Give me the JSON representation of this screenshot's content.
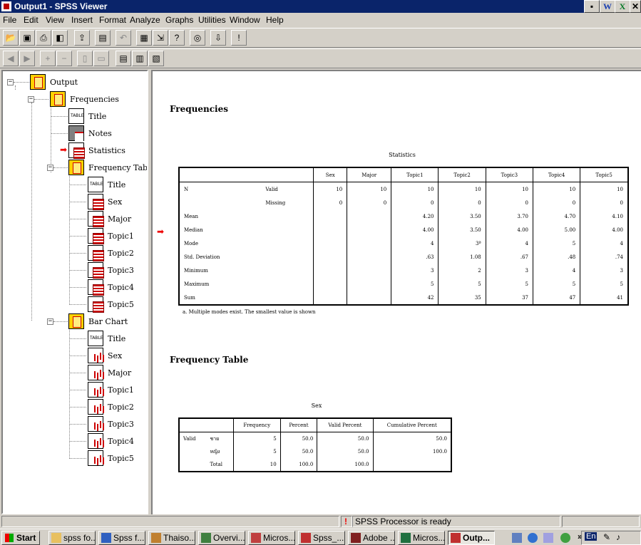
{
  "window": {
    "title": "Output1 - SPSS Viewer"
  },
  "office_icons": [
    "W",
    "X",
    "✕"
  ],
  "menu": [
    "File",
    "Edit",
    "View",
    "Insert",
    "Format",
    "Analyze",
    "Graphs",
    "Utilities",
    "Window",
    "Help"
  ],
  "toolbar1": [
    "open-icon",
    "save-icon",
    "print-icon",
    "print-preview-icon",
    "export-icon",
    "dialog-recall-icon",
    "undo-icon",
    "goto-data-icon",
    "goto-case-icon",
    "variables-icon",
    "use-sets-icon",
    "designate-window-icon",
    "info-icon"
  ],
  "toolbar2": [
    "promote-icon",
    "demote-icon",
    "expand-icon",
    "collapse-icon",
    "show-icon",
    "hide-icon",
    "insert-heading-icon",
    "insert-title-icon",
    "insert-text-icon"
  ],
  "tree": {
    "root": "Output",
    "frequencies": "Frequencies",
    "freq_children": [
      "Title",
      "Notes",
      "Statistics"
    ],
    "freq_table": "Frequency Table",
    "table_children": [
      "Title",
      "Sex",
      "Major",
      "Topic1",
      "Topic2",
      "Topic3",
      "Topic4",
      "Topic5"
    ],
    "bar_chart": "Bar Chart",
    "chart_children": [
      "Title",
      "Sex",
      "Major",
      "Topic1",
      "Topic2",
      "Topic3",
      "Topic4",
      "Topic5"
    ]
  },
  "content": {
    "heading1": "Frequencies",
    "stats_caption": "Statistics",
    "stats_columns": [
      "",
      "",
      "Sex",
      "Major",
      "Topic1",
      "Topic2",
      "Topic3",
      "Topic4",
      "Topic5"
    ],
    "stats_rows": [
      [
        "N",
        "Valid",
        "10",
        "10",
        "10",
        "10",
        "10",
        "10",
        "10"
      ],
      [
        "",
        "Missing",
        "0",
        "0",
        "0",
        "0",
        "0",
        "0",
        "0"
      ],
      [
        "Mean",
        "",
        "",
        "",
        "4.20",
        "3.50",
        "3.70",
        "4.70",
        "4.10"
      ],
      [
        "Median",
        "",
        "",
        "",
        "4.00",
        "3.50",
        "4.00",
        "5.00",
        "4.00"
      ],
      [
        "Mode",
        "",
        "",
        "",
        "4",
        "3ª",
        "4",
        "5",
        "4"
      ],
      [
        "Std. Deviation",
        "",
        "",
        "",
        ".63",
        "1.08",
        ".67",
        ".48",
        ".74"
      ],
      [
        "Minimum",
        "",
        "",
        "",
        "3",
        "2",
        "3",
        "4",
        "3"
      ],
      [
        "Maximum",
        "",
        "",
        "",
        "5",
        "5",
        "5",
        "5",
        "5"
      ],
      [
        "Sum",
        "",
        "",
        "",
        "42",
        "35",
        "37",
        "47",
        "41"
      ]
    ],
    "footnote": "a. Multiple modes exist. The smallest value is shown",
    "heading2": "Frequency Table",
    "freq_caption": "Sex",
    "freq_columns": [
      "",
      "",
      "Frequency",
      "Percent",
      "Valid Percent",
      "Cumulative Percent"
    ],
    "freq_rows": [
      [
        "Valid",
        "ชาย",
        "5",
        "50.0",
        "50.0",
        "50.0"
      ],
      [
        "",
        "หญิง",
        "5",
        "50.0",
        "50.0",
        "100.0"
      ],
      [
        "",
        "Total",
        "10",
        "100.0",
        "100.0",
        ""
      ]
    ]
  },
  "status": {
    "processor": "SPSS Processor  is ready"
  },
  "taskbar": {
    "start": "Start",
    "tasks": [
      "spss fo...",
      "Spss f...",
      "Thaiso...",
      "Overvi...",
      "Micros...",
      "Spss_...",
      "Adobe ...",
      "Micros...",
      "Outp..."
    ],
    "lang": "En"
  }
}
